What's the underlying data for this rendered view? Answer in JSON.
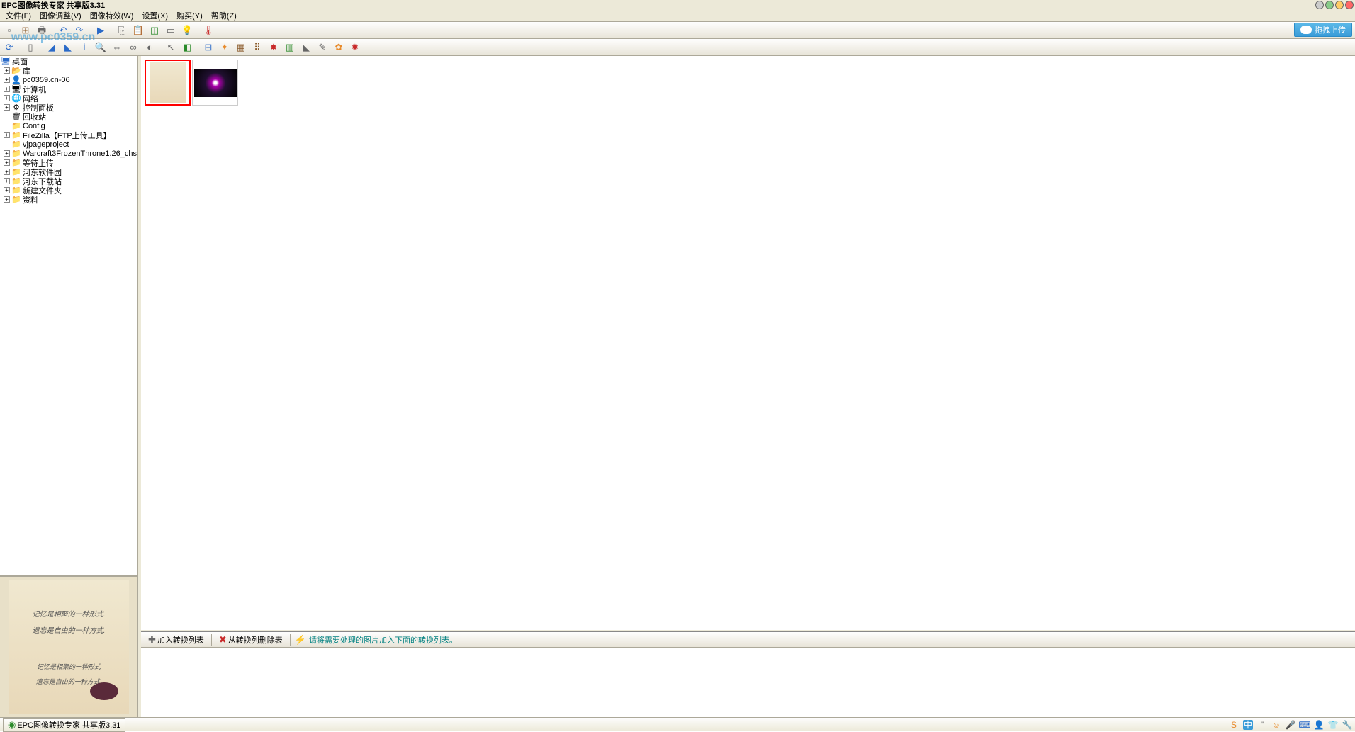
{
  "app": {
    "title": "EPC图像转换专家  共享版3.31",
    "taskbar_title": "EPC图像转换专家  共享版3.31"
  },
  "menu": {
    "file": "文件(F)",
    "adjust": "图像调整(V)",
    "effects": "图像特效(W)",
    "settings": "设置(X)",
    "buy": "购买(Y)",
    "help": "帮助(Z)"
  },
  "upload_btn": "拖拽上传",
  "tree": {
    "root": "桌面",
    "items": [
      {
        "label": "库",
        "icon": "folder-open",
        "exp": "+"
      },
      {
        "label": "pc0359.cn-06",
        "icon": "user",
        "exp": "+"
      },
      {
        "label": "计算机",
        "icon": "computer",
        "exp": "+"
      },
      {
        "label": "网络",
        "icon": "network",
        "exp": "+"
      },
      {
        "label": "控制面板",
        "icon": "control-panel",
        "exp": "+"
      },
      {
        "label": "回收站",
        "icon": "recycle",
        "exp": ""
      },
      {
        "label": "Config",
        "icon": "folder",
        "exp": ""
      },
      {
        "label": "FileZilla【FTP上传工具】",
        "icon": "folder",
        "exp": "+"
      },
      {
        "label": "vjpageproject",
        "icon": "folder",
        "exp": ""
      },
      {
        "label": "Warcraft3FrozenThrone1.26_chs",
        "icon": "folder",
        "exp": "+"
      },
      {
        "label": "等待上传",
        "icon": "folder",
        "exp": "+"
      },
      {
        "label": "河东软件园",
        "icon": "folder",
        "exp": "+"
      },
      {
        "label": "河东下载站",
        "icon": "folder",
        "exp": "+"
      },
      {
        "label": "新建文件夹",
        "icon": "folder",
        "exp": "+"
      },
      {
        "label": "资料",
        "icon": "folder",
        "exp": "+"
      }
    ]
  },
  "preview": {
    "line1": "记忆是相聚的一种形式.",
    "line2": "遗忘是自由的一种方式.",
    "line3": "记忆是相聚的一种形式",
    "line4": "遗忘是自由的一种方式."
  },
  "bottom": {
    "add": "加入转换列表",
    "remove": "从转换列删除表",
    "hint": "请将需要处理的图片加入下面的转换列表。"
  },
  "watermark": "www.pc0359.cn",
  "tray": {
    "ime": "中"
  }
}
